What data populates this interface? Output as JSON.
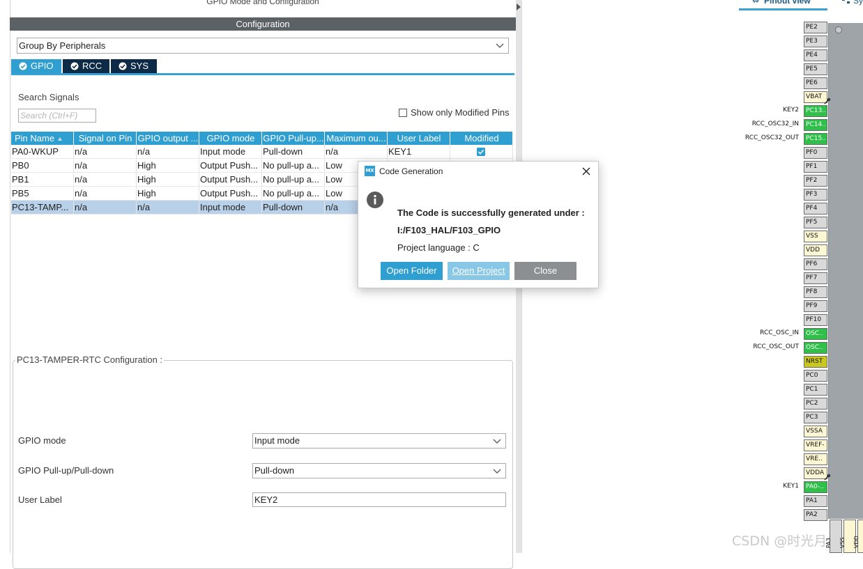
{
  "panel": {
    "title": "GPIO Mode and Configuration",
    "config_header": "Configuration",
    "group_select": "Group By Peripherals",
    "tabs": [
      {
        "label": "GPIO"
      },
      {
        "label": "RCC"
      },
      {
        "label": "SYS"
      }
    ],
    "search_label": "Search Signals",
    "search_placeholder": "Search (Ctrl+F)",
    "show_modified_label": "Show only Modified Pins",
    "table": {
      "headers": [
        "Pin Name",
        "Signal on Pin",
        "GPIO output ...",
        "GPIO mode",
        "GPIO Pull-up...",
        "Maximum ou...",
        "User Label",
        "Modified"
      ],
      "rows": [
        {
          "pin": "PA0-WKUP",
          "signal": "n/a",
          "output": "n/a",
          "mode": "Input mode",
          "pull": "Pull-down",
          "speed": "n/a",
          "label": "KEY1",
          "modified": true
        },
        {
          "pin": "PB0",
          "signal": "n/a",
          "output": "High",
          "mode": "Output Push...",
          "pull": "No pull-up a...",
          "speed": "Low",
          "label": "",
          "modified": false
        },
        {
          "pin": "PB1",
          "signal": "n/a",
          "output": "High",
          "mode": "Output Push...",
          "pull": "No pull-up a...",
          "speed": "Low",
          "label": "",
          "modified": false
        },
        {
          "pin": "PB5",
          "signal": "n/a",
          "output": "High",
          "mode": "Output Push...",
          "pull": "No pull-up a...",
          "speed": "Low",
          "label": "",
          "modified": false
        },
        {
          "pin": "PC13-TAMP...",
          "signal": "n/a",
          "output": "n/a",
          "mode": "Input mode",
          "pull": "Pull-down",
          "speed": "n/a",
          "label": "",
          "modified": false
        }
      ]
    },
    "config_section": {
      "legend": "PC13-TAMPER-RTC Configuration :",
      "gpio_mode_label": "GPIO mode",
      "gpio_mode_value": "Input mode",
      "pull_label": "GPIO Pull-up/Pull-down",
      "pull_value": "Pull-down",
      "user_label_label": "User Label",
      "user_label_value": "KEY2"
    }
  },
  "pinout": {
    "tab_label": "Pinout view",
    "sys_tab_label": "Sy",
    "pins": [
      {
        "name": "PE2",
        "color": "#d9d9d9",
        "label": ""
      },
      {
        "name": "PE3",
        "color": "#d9d9d9",
        "label": ""
      },
      {
        "name": "PE4",
        "color": "#d9d9d9",
        "label": ""
      },
      {
        "name": "PE5",
        "color": "#d9d9d9",
        "label": ""
      },
      {
        "name": "PE6",
        "color": "#d9d9d9",
        "label": ""
      },
      {
        "name": "VBAT",
        "color": "#fdf6d3",
        "label": ""
      },
      {
        "name": "PC13..",
        "color": "#2fc04a",
        "label": "KEY2"
      },
      {
        "name": "PC14..",
        "color": "#2fc04a",
        "label": "RCC_OSC32_IN"
      },
      {
        "name": "PC15..",
        "color": "#2fc04a",
        "label": "RCC_OSC32_OUT"
      },
      {
        "name": "PF0",
        "color": "#d9d9d9",
        "label": ""
      },
      {
        "name": "PF1",
        "color": "#d9d9d9",
        "label": ""
      },
      {
        "name": "PF2",
        "color": "#d9d9d9",
        "label": ""
      },
      {
        "name": "PF3",
        "color": "#d9d9d9",
        "label": ""
      },
      {
        "name": "PF4",
        "color": "#d9d9d9",
        "label": ""
      },
      {
        "name": "PF5",
        "color": "#d9d9d9",
        "label": ""
      },
      {
        "name": "VSS",
        "color": "#fdf6d3",
        "label": ""
      },
      {
        "name": "VDD",
        "color": "#fdf6d3",
        "label": ""
      },
      {
        "name": "PF6",
        "color": "#d9d9d9",
        "label": ""
      },
      {
        "name": "PF7",
        "color": "#d9d9d9",
        "label": ""
      },
      {
        "name": "PF8",
        "color": "#d9d9d9",
        "label": ""
      },
      {
        "name": "PF9",
        "color": "#d9d9d9",
        "label": ""
      },
      {
        "name": "PF10",
        "color": "#d9d9d9",
        "label": ""
      },
      {
        "name": "OSC..",
        "color": "#2fc04a",
        "label": "RCC_OSC_IN"
      },
      {
        "name": "OSC..",
        "color": "#2fc04a",
        "label": "RCC_OSC_OUT"
      },
      {
        "name": "NRST",
        "color": "#c8c820",
        "label": ""
      },
      {
        "name": "PC0",
        "color": "#d9d9d9",
        "label": ""
      },
      {
        "name": "PC1",
        "color": "#d9d9d9",
        "label": ""
      },
      {
        "name": "PC2",
        "color": "#d9d9d9",
        "label": ""
      },
      {
        "name": "PC3",
        "color": "#d9d9d9",
        "label": ""
      },
      {
        "name": "VSSA",
        "color": "#fdf6d3",
        "label": ""
      },
      {
        "name": "VREF-",
        "color": "#fdf6d3",
        "label": ""
      },
      {
        "name": "VRE..",
        "color": "#fdf6d3",
        "label": ""
      },
      {
        "name": "VDDA",
        "color": "#fdf6d3",
        "label": ""
      },
      {
        "name": "PA0-..",
        "color": "#2fc04a",
        "label": "KEY1"
      },
      {
        "name": "PA1",
        "color": "#d9d9d9",
        "label": ""
      },
      {
        "name": "PA2",
        "color": "#d9d9d9",
        "label": ""
      }
    ],
    "bottom_pins": [
      {
        "name": "PA3",
        "color": "#d9d9d9"
      },
      {
        "name": "VSS",
        "color": "#fdf6d3"
      },
      {
        "name": "VDD",
        "color": "#fdf6d3"
      }
    ]
  },
  "dialog": {
    "title": "Code Generation",
    "message": "The Code is successfully generated under :",
    "path": "I:/F103_HAL/F103_GPIO",
    "language": "Project language : C",
    "buttons": {
      "open_folder": "Open Folder",
      "open_project": "Open Project",
      "close": "Close"
    }
  },
  "watermark": "CSDN @时光月"
}
